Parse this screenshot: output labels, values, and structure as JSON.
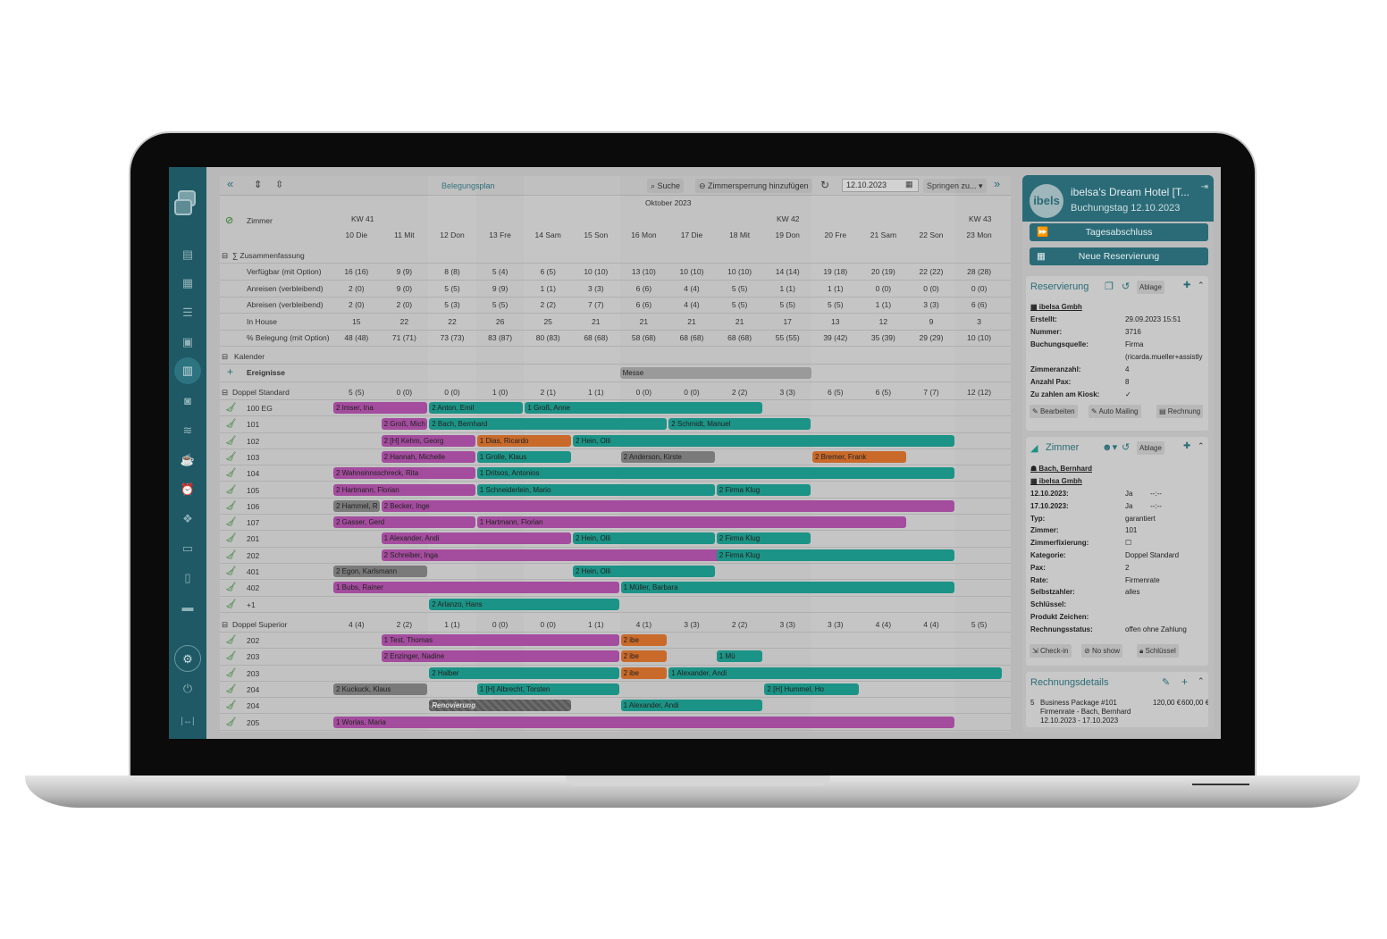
{
  "laptop": {
    "frame": "laptop"
  },
  "sidebar": {
    "icons": [
      "logo-icon",
      "news-icon",
      "grid-icon",
      "list-icon",
      "contacts-icon",
      "calendar-icon",
      "money-icon",
      "database-icon",
      "coffee-icon",
      "alarm-icon",
      "gift-icon",
      "folder-icon",
      "document-icon",
      "card-icon",
      "settings-icon",
      "power-icon",
      "expand-icon"
    ]
  },
  "toolbar": {
    "title": "Belegungsplan",
    "search": "Suche",
    "block": "Zimmersperrung hinzufügen",
    "date": "12.10.2023",
    "jump": "Springen zu..."
  },
  "header": {
    "room_col": "Zimmer",
    "month": "Oktober 2023",
    "weeks": [
      "KW 41",
      "KW 42",
      "KW 43"
    ],
    "days": [
      "10 Die",
      "11 Mit",
      "12 Don",
      "13 Fre",
      "14 Sam",
      "15 Son",
      "16 Mon",
      "17 Die",
      "18 Mit",
      "19 Don",
      "20 Fre",
      "21 Sam",
      "22 Son",
      "23 Mon"
    ]
  },
  "summary": {
    "title": "∑ Zusammenfassung",
    "rows": [
      {
        "label": "Verfügbar (mit Option)",
        "values": [
          "16 (16)",
          "9 (9)",
          "8 (8)",
          "5 (4)",
          "6 (5)",
          "10 (10)",
          "13 (10)",
          "10 (10)",
          "10 (10)",
          "14 (14)",
          "19 (18)",
          "20 (19)",
          "22 (22)",
          "28 (28)"
        ]
      },
      {
        "label": "Anreisen (verbleibend)",
        "values": [
          "2 (0)",
          "9 (0)",
          "5 (5)",
          "9 (9)",
          "1 (1)",
          "3 (3)",
          "6 (6)",
          "4 (4)",
          "5 (5)",
          "1 (1)",
          "1 (1)",
          "0 (0)",
          "0 (0)",
          "0 (0)"
        ]
      },
      {
        "label": "Abreisen (verbleibend)",
        "values": [
          "2 (0)",
          "2 (0)",
          "5 (3)",
          "5 (5)",
          "2 (2)",
          "7 (7)",
          "6 (6)",
          "4 (4)",
          "5 (5)",
          "5 (5)",
          "5 (5)",
          "1 (1)",
          "3 (3)",
          "6 (6)"
        ]
      },
      {
        "label": "In House",
        "values": [
          "15",
          "22",
          "22",
          "26",
          "25",
          "21",
          "21",
          "21",
          "21",
          "17",
          "13",
          "12",
          "9",
          "3"
        ]
      },
      {
        "label": "% Belegung (mit Option)",
        "values": [
          "48 (48)",
          "71 (71)",
          "73 (73)",
          "83 (87)",
          "80 (83)",
          "68 (68)",
          "58 (68)",
          "68 (68)",
          "68 (68)",
          "55 (55)",
          "39 (42)",
          "35 (39)",
          "29 (29)",
          "10 (10)"
        ]
      }
    ]
  },
  "calendar": {
    "title": "Kalender",
    "events_label": "Ereignisse",
    "event": "Messe"
  },
  "group1": {
    "title": "Doppel Standard",
    "values": [
      "5 (5)",
      "0 (0)",
      "0 (0)",
      "1 (0)",
      "2 (1)",
      "1 (1)",
      "0 (0)",
      "0 (0)",
      "2 (2)",
      "3 (3)",
      "6 (5)",
      "6 (5)",
      "7 (7)",
      "12 (12)"
    ]
  },
  "rooms1": [
    "100 EG",
    "101",
    "102",
    "103",
    "104",
    "105",
    "106",
    "107",
    "201",
    "202",
    "401",
    "402",
    "+1"
  ],
  "group2": {
    "title": "Doppel Superior",
    "values": [
      "4 (4)",
      "2 (2)",
      "1 (1)",
      "0 (0)",
      "0 (0)",
      "1 (1)",
      "4 (1)",
      "3 (3)",
      "2 (2)",
      "3 (3)",
      "3 (3)",
      "4 (4)",
      "4 (4)",
      "5 (5)"
    ]
  },
  "rooms2": [
    "202",
    "203",
    "203",
    "204",
    "204",
    "205"
  ],
  "bookings": [
    {
      "row": 0,
      "label": "2 Imser, Ina"
    },
    {
      "row": 0,
      "label": "2 Anton, Emil"
    },
    {
      "row": 0,
      "label": "1 Groß, Anne"
    },
    {
      "row": 1,
      "label": "2 Groß, Mich"
    },
    {
      "row": 1,
      "label": "2 Bach, Bernhard"
    },
    {
      "row": 1,
      "label": "2 Schmidt, Manuel"
    },
    {
      "row": 2,
      "label": "2 [H] Kehm, Georg"
    },
    {
      "row": 2,
      "label": "1 Dias, Ricardo"
    },
    {
      "row": 2,
      "label": "2 Hein, Olli"
    },
    {
      "row": 3,
      "label": "2 Hannah, Michelle"
    },
    {
      "row": 3,
      "label": "1 Grolle, Klaus"
    },
    {
      "row": 3,
      "label": "2 Anderson, Kirste"
    },
    {
      "row": 3,
      "label": "2 Bremer, Frank"
    },
    {
      "row": 4,
      "label": "2 Wahnsinnsschreck, Rita"
    },
    {
      "row": 4,
      "label": "1 Dritsos, Antonios"
    },
    {
      "row": 5,
      "label": "2 Hartmann, Florian"
    },
    {
      "row": 5,
      "label": "1 Schneiderlein, Mario"
    },
    {
      "row": 5,
      "label": "2 Firma Klug"
    },
    {
      "row": 6,
      "label": "2 Hammel, R"
    },
    {
      "row": 6,
      "label": "2 Becker, Inge"
    },
    {
      "row": 7,
      "label": "2 Gasser, Gerd"
    },
    {
      "row": 7,
      "label": "1 Hartmann, Florian"
    },
    {
      "row": 8,
      "label": "1 Alexander, Andi"
    },
    {
      "row": 8,
      "label": "2 Hein, Olli"
    },
    {
      "row": 8,
      "label": "2 Firma Klug"
    },
    {
      "row": 9,
      "label": "2 Schreiber, Inga"
    },
    {
      "row": 9,
      "label": "2 Firma Klug"
    },
    {
      "row": 10,
      "label": "2 Egon, Karlsmann"
    },
    {
      "row": 10,
      "label": "2 Hein, Olli"
    },
    {
      "row": 11,
      "label": "1 Bubs, Rainer"
    },
    {
      "row": 11,
      "label": "1 Müller, Barbara"
    },
    {
      "row": 12,
      "label": "2 Arlanzo, Hans"
    },
    {
      "row": 13,
      "label": "1 Test, Thomas"
    },
    {
      "row": 13,
      "label": "2 ibe"
    },
    {
      "row": 14,
      "label": "2 Enzinger, Nadine"
    },
    {
      "row": 14,
      "label": "2 ibe"
    },
    {
      "row": 14,
      "label": "1 Mü"
    },
    {
      "row": 15,
      "label": "2 Halber"
    },
    {
      "row": 15,
      "label": "2 ibe"
    },
    {
      "row": 15,
      "label": "1 Alexander, Andi"
    },
    {
      "row": 16,
      "label": "2 Kuckuck, Klaus"
    },
    {
      "row": 16,
      "label": "1 [H] Albrecht, Torsten"
    },
    {
      "row": 16,
      "label": "2 [H] Hummel, Ho"
    },
    {
      "row": 17,
      "label": "Renovierung"
    },
    {
      "row": 17,
      "label": "1 Alexander, Andi"
    },
    {
      "row": 18,
      "label": "1 Worlas, Maria"
    }
  ],
  "right": {
    "hotel": "ibelsa's Dream Hotel [T...",
    "avatar": "ibels",
    "day": "Buchungstag 12.10.2023",
    "day_close": "Tagesabschluss",
    "new_res": "Neue Reservierung",
    "res": {
      "title": "Reservierung",
      "ablage": "Ablage",
      "company": "ibelsa Gmbh",
      "fields": [
        {
          "k": "Erstellt:",
          "v": "29.09.2023 15:51"
        },
        {
          "k": "Nummer:",
          "v": "3716"
        },
        {
          "k": "Buchungsquelle:",
          "v": "Firma"
        },
        {
          "k": "",
          "v": "(ricarda.mueller+assistly"
        },
        {
          "k": "Zimmeranzahl:",
          "v": "4"
        },
        {
          "k": "Anzahl Pax:",
          "v": "8"
        },
        {
          "k": "Zu zahlen am Kiosk:",
          "v": "✓"
        }
      ],
      "actions": [
        "Bearbeiten",
        "Auto Mailing",
        "Rechnung"
      ]
    },
    "room": {
      "title": "Zimmer",
      "ablage": "Ablage",
      "guest": "Bach, Bernhard",
      "company": "ibelsa Gmbh",
      "fields": [
        {
          "k": "12.10.2023:",
          "v": "Ja"
        },
        {
          "k": "17.10.2023:",
          "v": "Ja"
        },
        {
          "k": "Typ:",
          "v": "garantiert"
        },
        {
          "k": "Zimmer:",
          "v": "101"
        },
        {
          "k": "Zimmerfixierung:",
          "v": "☐"
        },
        {
          "k": "Kategorie:",
          "v": "Doppel Standard"
        },
        {
          "k": "Pax:",
          "v": "2"
        },
        {
          "k": "Rate:",
          "v": "Firmenrate"
        },
        {
          "k": "Selbstzahler:",
          "v": "alles"
        },
        {
          "k": "Schlüssel:",
          "v": ""
        },
        {
          "k": "Produkt Zeichen:",
          "v": ""
        },
        {
          "k": "Rechnungsstatus:",
          "v": "offen ohne Zahlung"
        }
      ],
      "times": [
        "--:--",
        "--:--"
      ],
      "actions": [
        "Check-in",
        "No show",
        "Schlüssel"
      ]
    },
    "invoice": {
      "title": "Rechnungsdetails",
      "qty": "5",
      "item": "Business Package #101",
      "sub": "Firmenrate - Bach, Bernhard",
      "range": "12.10.2023 - 17.10.2023",
      "price": "120,00 €",
      "total": "600,00 €"
    }
  }
}
